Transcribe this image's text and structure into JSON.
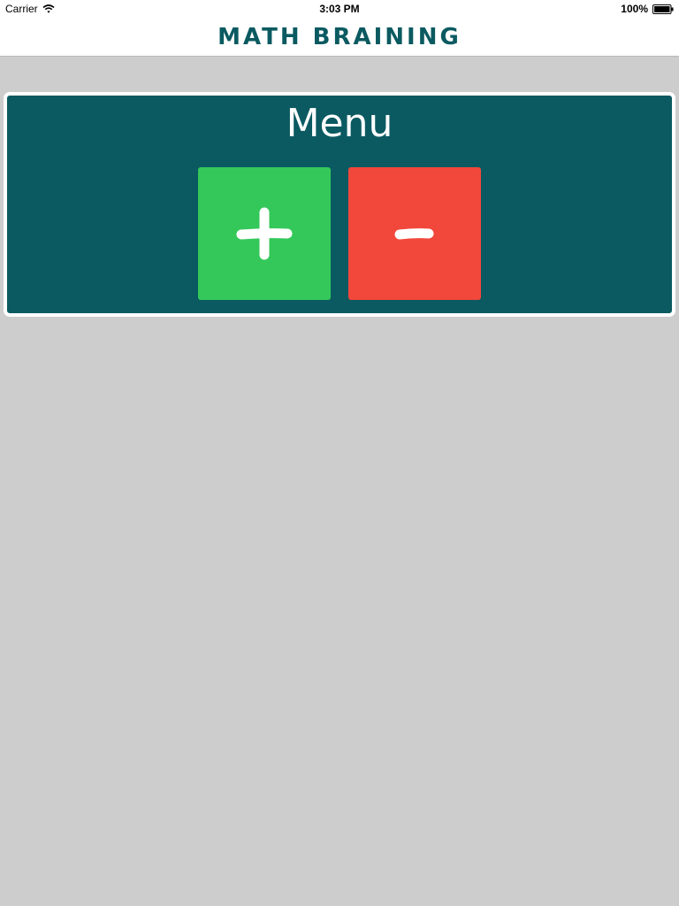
{
  "status_bar": {
    "carrier": "Carrier",
    "time": "3:03 PM",
    "battery": "100%"
  },
  "nav": {
    "title": "MATH BRAINING"
  },
  "menu": {
    "title": "Menu",
    "buttons": [
      {
        "name": "addition",
        "icon": "plus-icon",
        "color": "#34c85a"
      },
      {
        "name": "subtraction",
        "icon": "minus-icon",
        "color": "#f2473b"
      }
    ]
  },
  "colors": {
    "background": "#cdcdcd",
    "panel": "#0b5a61",
    "title": "#0b5a61",
    "plus": "#34c85a",
    "minus": "#f2473b"
  }
}
